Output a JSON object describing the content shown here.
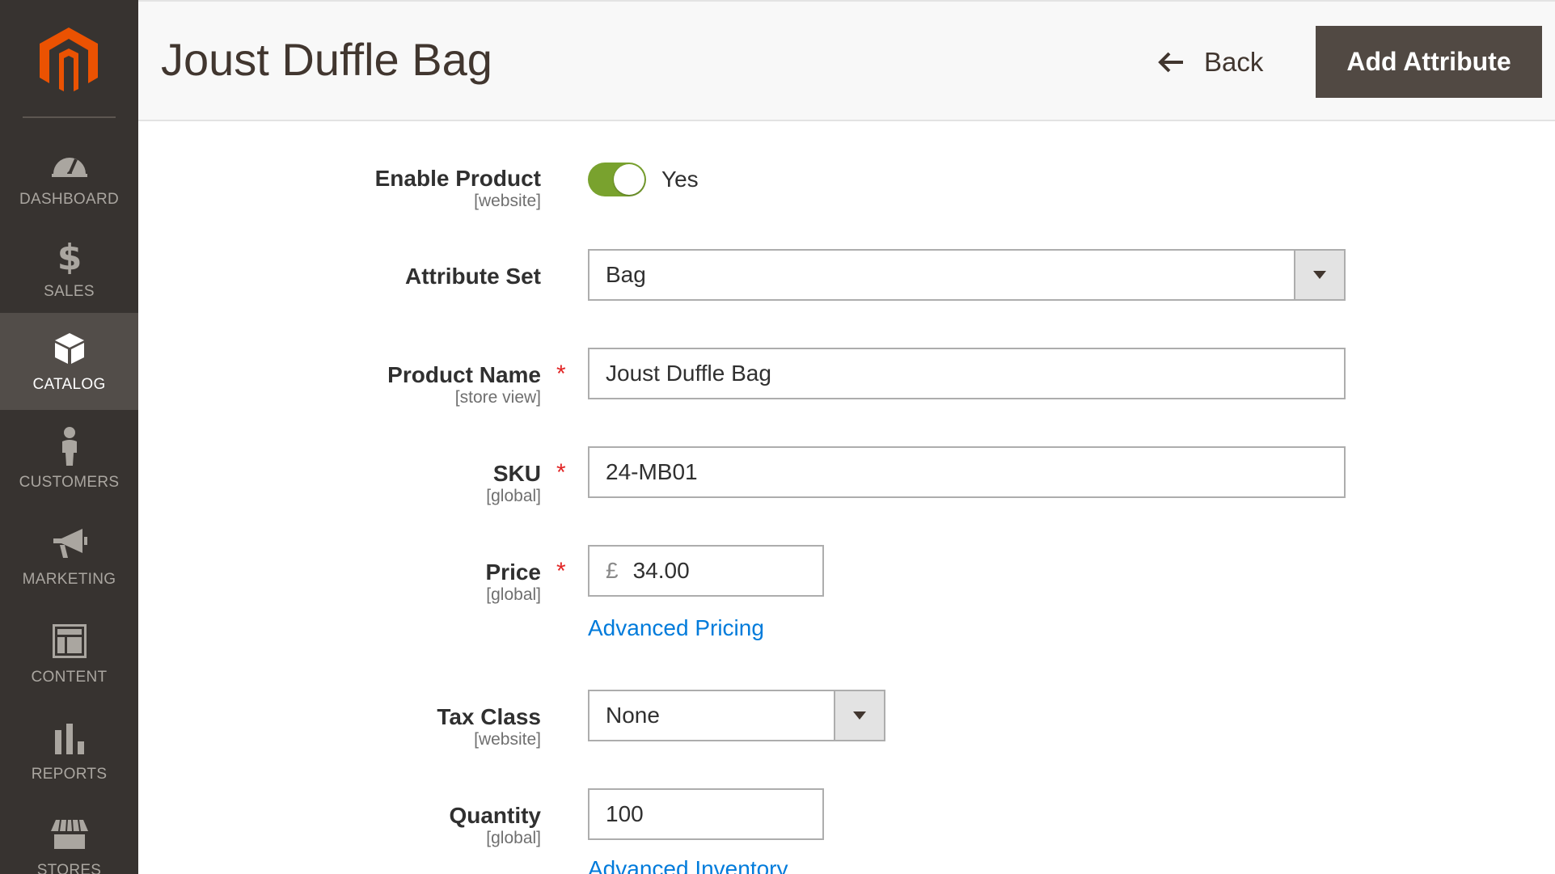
{
  "sidebar": {
    "items": [
      {
        "label": "DASHBOARD",
        "icon": "dashboard-gauge-icon",
        "active": false
      },
      {
        "label": "SALES",
        "icon": "dollar-icon",
        "active": false
      },
      {
        "label": "CATALOG",
        "icon": "box-icon",
        "active": true
      },
      {
        "label": "CUSTOMERS",
        "icon": "person-icon",
        "active": false
      },
      {
        "label": "MARKETING",
        "icon": "megaphone-icon",
        "active": false
      },
      {
        "label": "CONTENT",
        "icon": "layout-icon",
        "active": false
      },
      {
        "label": "REPORTS",
        "icon": "bar-chart-icon",
        "active": false
      },
      {
        "label": "STORES",
        "icon": "storefront-icon",
        "active": false
      }
    ]
  },
  "header": {
    "title": "Joust Duffle Bag",
    "back_label": "Back",
    "add_attribute_label": "Add Attribute"
  },
  "form": {
    "enable_product": {
      "label": "Enable Product",
      "scope": "[website]",
      "value": "Yes",
      "enabled": true
    },
    "attribute_set": {
      "label": "Attribute Set",
      "value": "Bag"
    },
    "product_name": {
      "label": "Product Name",
      "scope": "[store view]",
      "value": "Joust Duffle Bag",
      "required_mark": "*"
    },
    "sku": {
      "label": "SKU",
      "scope": "[global]",
      "value": "24-MB01",
      "required_mark": "*"
    },
    "price": {
      "label": "Price",
      "scope": "[global]",
      "currency": "£",
      "value": "34.00",
      "required_mark": "*",
      "link": "Advanced Pricing"
    },
    "tax_class": {
      "label": "Tax Class",
      "scope": "[website]",
      "value": "None"
    },
    "quantity": {
      "label": "Quantity",
      "scope": "[global]",
      "value": "100",
      "link": "Advanced Inventory"
    }
  },
  "colors": {
    "sidebar_bg": "#373330",
    "sidebar_active_bg": "#524d49",
    "logo_orange": "#eb5202",
    "primary_button": "#514943",
    "toggle_on": "#79a22e",
    "link": "#007bdb",
    "required": "#e22626"
  }
}
